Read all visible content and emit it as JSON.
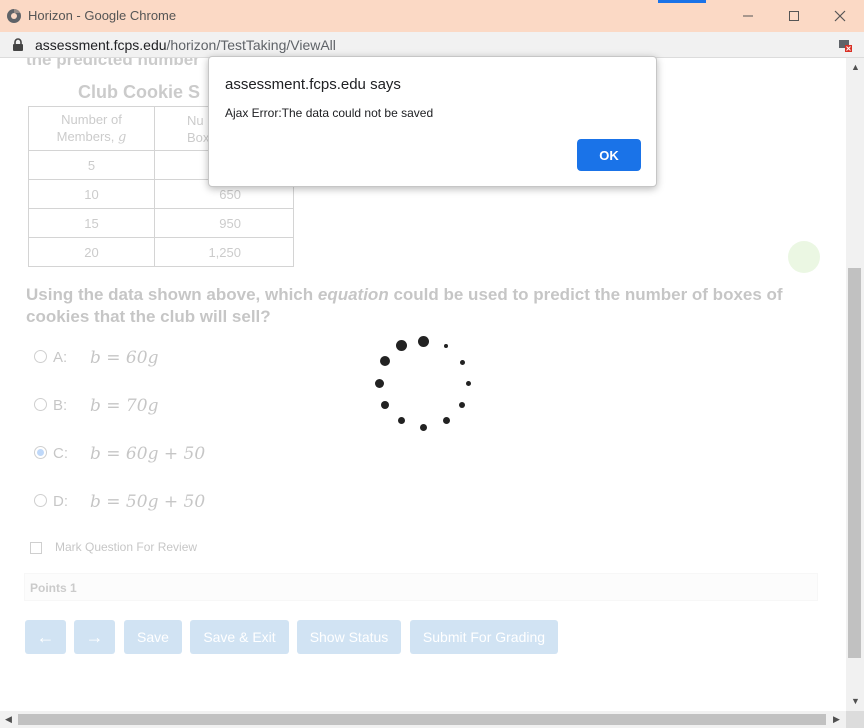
{
  "window": {
    "title": "Horizon - Google Chrome",
    "titlebar_color": "#fbd9c5"
  },
  "address_bar": {
    "domain": "assessment.fcps.edu",
    "path": "/horizon/TestTaking/ViewAll"
  },
  "page": {
    "cut_text": "the predicted number",
    "table": {
      "title": "Club Cookie S",
      "headers": [
        {
          "line1": "Number of",
          "line2": "Members,",
          "var": "g"
        },
        {
          "line1": "Nu",
          "line2": "Boxe"
        }
      ],
      "rows": [
        {
          "members": "5",
          "boxes": ""
        },
        {
          "members": "10",
          "boxes": "650"
        },
        {
          "members": "15",
          "boxes": "950"
        },
        {
          "members": "20",
          "boxes": "1,250"
        }
      ]
    },
    "question": {
      "part1": "Using the data shown above, which ",
      "emphasis": "equation",
      "part2": " could be used to predict the number of boxes of cookies that the club will sell?"
    },
    "options": [
      {
        "letter": "A:",
        "equation": "b = 60g",
        "selected": false
      },
      {
        "letter": "B:",
        "equation": "b = 70g",
        "selected": false
      },
      {
        "letter": "C:",
        "equation": "b = 60g + 50",
        "selected": true
      },
      {
        "letter": "D:",
        "equation": "b = 50g + 50",
        "selected": false
      }
    ],
    "review_label": "Mark Question For Review",
    "points_label": "Points 1",
    "buttons": {
      "prev": "←",
      "next": "→",
      "save": "Save",
      "save_exit": "Save & Exit",
      "show_status": "Show Status",
      "submit": "Submit For Grading"
    }
  },
  "dialog": {
    "title": "assessment.fcps.edu says",
    "message": "Ajax Error:The data could not be saved",
    "ok_label": "OK",
    "ok_color": "#1a73e8"
  }
}
